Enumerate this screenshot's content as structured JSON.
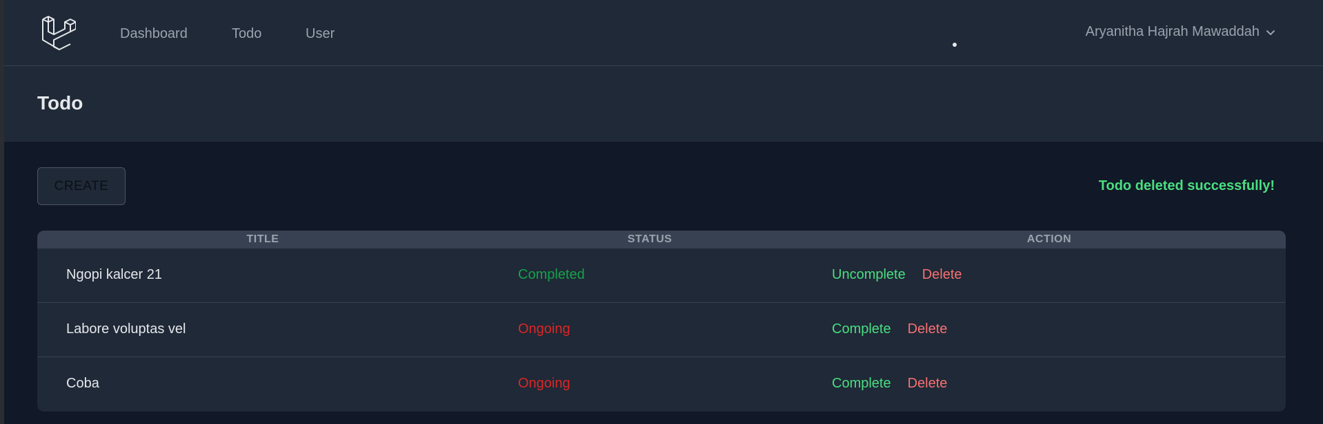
{
  "nav": {
    "links": [
      "Dashboard",
      "Todo",
      "User"
    ],
    "user_name": "Aryanitha Hajrah Mawaddah"
  },
  "header": {
    "title": "Todo"
  },
  "toolbar": {
    "create_label": "CREATE",
    "flash_message": "Todo deleted successfully!"
  },
  "table": {
    "columns": [
      "TITLE",
      "STATUS",
      "ACTION"
    ],
    "rows": [
      {
        "title": "Ngopi kalcer 21",
        "status": "Completed",
        "toggle_action": "Uncomplete",
        "delete_action": "Delete"
      },
      {
        "title": "Labore voluptas vel",
        "status": "Ongoing",
        "toggle_action": "Complete",
        "delete_action": "Delete"
      },
      {
        "title": "Coba",
        "status": "Ongoing",
        "toggle_action": "Complete",
        "delete_action": "Delete"
      }
    ]
  },
  "colors": {
    "completed": "#16a34a",
    "ongoing": "#dc2626",
    "complete_action": "#4ade80",
    "delete_action": "#f87171",
    "flash": "#4ade80",
    "logo": "#e5e7eb"
  },
  "icons": {
    "logo": "laravel-logo-icon",
    "user_menu": "chevron-down-icon"
  }
}
